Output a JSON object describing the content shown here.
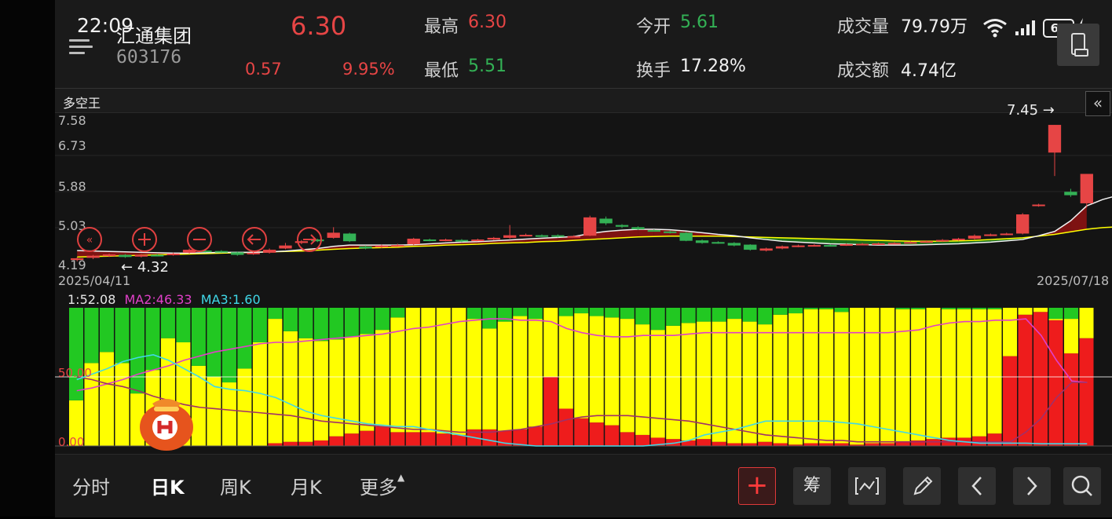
{
  "status_bar": {
    "time": "22:09",
    "battery": "60"
  },
  "stock": {
    "name": "汇通集团",
    "code": "603176",
    "price": "6.30",
    "change": "0.57",
    "change_pct": "9.95%"
  },
  "quote": {
    "high_label": "最高",
    "high": "6.30",
    "low_label": "最低",
    "low": "5.51",
    "open_label": "今开",
    "open": "5.61",
    "turnover_label": "换手",
    "turnover": "17.28%",
    "volume_label": "成交量",
    "volume": "79.79万",
    "amount_label": "成交额",
    "amount": "4.74亿"
  },
  "chart_title": "多空王",
  "colors": {
    "up": "#e64545",
    "down": "#33b155",
    "yellow": "#ffff00",
    "ma1": "#e0e0e0",
    "ma2": "#e040c8",
    "ma3": "#40d8e8"
  },
  "chart_data": [
    {
      "type": "candlestick",
      "title": "多空王",
      "y_ticks": [
        "7.58",
        "6.73",
        "5.88",
        "5.03",
        "4.19"
      ],
      "ylim": [
        4.19,
        7.58
      ],
      "x_start": "2025/04/11",
      "x_end": "2025/07/18",
      "annotations": {
        "high_marker": "7.45",
        "low_marker": "4.32"
      },
      "candles": [
        {
          "o": 4.28,
          "c": 4.32,
          "h": 4.34,
          "l": 4.25
        },
        {
          "o": 4.33,
          "c": 4.38,
          "h": 4.4,
          "l": 4.3
        },
        {
          "o": 4.37,
          "c": 4.41,
          "h": 4.43,
          "l": 4.35
        },
        {
          "o": 4.4,
          "c": 4.35,
          "h": 4.42,
          "l": 4.33
        },
        {
          "o": 4.36,
          "c": 4.4,
          "h": 4.42,
          "l": 4.34
        },
        {
          "o": 4.4,
          "c": 4.39,
          "h": 4.42,
          "l": 4.37
        },
        {
          "o": 4.4,
          "c": 4.43,
          "h": 4.45,
          "l": 4.38
        },
        {
          "o": 4.45,
          "c": 4.52,
          "h": 4.55,
          "l": 4.43
        },
        {
          "o": 4.5,
          "c": 4.48,
          "h": 4.52,
          "l": 4.46
        },
        {
          "o": 4.49,
          "c": 4.47,
          "h": 4.51,
          "l": 4.45
        },
        {
          "o": 4.46,
          "c": 4.4,
          "h": 4.48,
          "l": 4.38
        },
        {
          "o": 4.42,
          "c": 4.45,
          "h": 4.47,
          "l": 4.4
        },
        {
          "o": 4.45,
          "c": 4.52,
          "h": 4.55,
          "l": 4.43
        },
        {
          "o": 4.55,
          "c": 4.62,
          "h": 4.68,
          "l": 4.53
        },
        {
          "o": 4.68,
          "c": 4.72,
          "h": 4.75,
          "l": 4.65
        },
        {
          "o": 4.76,
          "c": 4.72,
          "h": 4.78,
          "l": 4.7
        },
        {
          "o": 4.8,
          "c": 4.92,
          "h": 5.05,
          "l": 4.78
        },
        {
          "o": 4.9,
          "c": 4.72,
          "h": 4.92,
          "l": 4.7
        },
        {
          "o": 4.6,
          "c": 4.55,
          "h": 4.62,
          "l": 4.53
        },
        {
          "o": 4.58,
          "c": 4.62,
          "h": 4.64,
          "l": 4.56
        },
        {
          "o": 4.62,
          "c": 4.63,
          "h": 4.66,
          "l": 4.6
        },
        {
          "o": 4.65,
          "c": 4.78,
          "h": 4.8,
          "l": 4.63
        },
        {
          "o": 4.76,
          "c": 4.74,
          "h": 4.78,
          "l": 4.72
        },
        {
          "o": 4.74,
          "c": 4.76,
          "h": 4.78,
          "l": 4.72
        },
        {
          "o": 4.75,
          "c": 4.73,
          "h": 4.77,
          "l": 4.7
        },
        {
          "o": 4.75,
          "c": 4.76,
          "h": 4.78,
          "l": 4.73
        },
        {
          "o": 4.76,
          "c": 4.8,
          "h": 4.82,
          "l": 4.74
        },
        {
          "o": 4.8,
          "c": 4.86,
          "h": 5.1,
          "l": 4.78
        },
        {
          "o": 4.86,
          "c": 4.87,
          "h": 4.9,
          "l": 4.84
        },
        {
          "o": 4.86,
          "c": 4.85,
          "h": 4.88,
          "l": 4.82
        },
        {
          "o": 4.86,
          "c": 4.83,
          "h": 4.88,
          "l": 4.81
        },
        {
          "o": 4.84,
          "c": 4.84,
          "h": 4.86,
          "l": 4.82
        },
        {
          "o": 4.85,
          "c": 5.28,
          "h": 5.32,
          "l": 4.84
        },
        {
          "o": 5.25,
          "c": 5.14,
          "h": 5.3,
          "l": 5.1
        },
        {
          "o": 5.1,
          "c": 5.06,
          "h": 5.12,
          "l": 5.03
        },
        {
          "o": 5.05,
          "c": 5.0,
          "h": 5.07,
          "l": 4.98
        },
        {
          "o": 4.98,
          "c": 4.97,
          "h": 5.0,
          "l": 4.95
        },
        {
          "o": 4.95,
          "c": 4.92,
          "h": 4.97,
          "l": 4.9
        },
        {
          "o": 4.92,
          "c": 4.73,
          "h": 4.94,
          "l": 4.72
        },
        {
          "o": 4.74,
          "c": 4.68,
          "h": 4.76,
          "l": 4.66
        },
        {
          "o": 4.7,
          "c": 4.68,
          "h": 4.72,
          "l": 4.66
        },
        {
          "o": 4.68,
          "c": 4.62,
          "h": 4.7,
          "l": 4.6
        },
        {
          "o": 4.64,
          "c": 4.52,
          "h": 4.65,
          "l": 4.5
        },
        {
          "o": 4.5,
          "c": 4.55,
          "h": 4.57,
          "l": 4.48
        },
        {
          "o": 4.55,
          "c": 4.6,
          "h": 4.62,
          "l": 4.53
        },
        {
          "o": 4.6,
          "c": 4.62,
          "h": 4.64,
          "l": 4.58
        },
        {
          "o": 4.62,
          "c": 4.63,
          "h": 4.65,
          "l": 4.6
        },
        {
          "o": 4.63,
          "c": 4.62,
          "h": 4.65,
          "l": 4.6
        },
        {
          "o": 4.63,
          "c": 4.65,
          "h": 4.67,
          "l": 4.61
        },
        {
          "o": 4.65,
          "c": 4.66,
          "h": 4.68,
          "l": 4.63
        },
        {
          "o": 4.66,
          "c": 4.67,
          "h": 4.69,
          "l": 4.64
        },
        {
          "o": 4.67,
          "c": 4.68,
          "h": 4.7,
          "l": 4.65
        },
        {
          "o": 4.68,
          "c": 4.7,
          "h": 4.72,
          "l": 4.66
        },
        {
          "o": 4.7,
          "c": 4.72,
          "h": 4.74,
          "l": 4.68
        },
        {
          "o": 4.72,
          "c": 4.75,
          "h": 4.77,
          "l": 4.7
        },
        {
          "o": 4.75,
          "c": 4.78,
          "h": 4.8,
          "l": 4.73
        },
        {
          "o": 4.78,
          "c": 4.85,
          "h": 4.88,
          "l": 4.76
        },
        {
          "o": 4.86,
          "c": 4.88,
          "h": 4.9,
          "l": 4.84
        },
        {
          "o": 4.88,
          "c": 4.9,
          "h": 4.92,
          "l": 4.86
        },
        {
          "o": 4.9,
          "c": 5.35,
          "h": 5.38,
          "l": 4.88
        },
        {
          "o": 5.55,
          "c": 5.58,
          "h": 5.6,
          "l": 5.53
        },
        {
          "o": 6.8,
          "c": 7.45,
          "h": 7.45,
          "l": 6.25
        },
        {
          "o": 5.88,
          "c": 5.8,
          "h": 5.95,
          "l": 5.76
        },
        {
          "o": 5.61,
          "c": 6.3,
          "h": 6.3,
          "l": 5.51
        }
      ],
      "ma_fast": [
        4.5,
        4.49,
        4.48,
        4.47,
        4.46,
        4.45,
        4.44,
        4.44,
        4.45,
        4.46,
        4.46,
        4.46,
        4.47,
        4.49,
        4.52,
        4.55,
        4.6,
        4.63,
        4.63,
        4.63,
        4.63,
        4.64,
        4.66,
        4.68,
        4.7,
        4.71,
        4.73,
        4.75,
        4.77,
        4.79,
        4.81,
        4.83,
        4.9,
        4.95,
        4.98,
        5.0,
        5.0,
        4.99,
        4.96,
        4.92,
        4.88,
        4.85,
        4.8,
        4.76,
        4.72,
        4.7,
        4.68,
        4.66,
        4.65,
        4.64,
        4.63,
        4.63,
        4.63,
        4.64,
        4.65,
        4.66,
        4.68,
        4.7,
        4.73,
        4.76,
        4.85,
        4.95,
        5.2,
        5.55,
        5.7,
        5.8
      ],
      "ma_slow": [
        4.35,
        4.36,
        4.37,
        4.38,
        4.39,
        4.4,
        4.41,
        4.42,
        4.43,
        4.44,
        4.45,
        4.46,
        4.47,
        4.48,
        4.49,
        4.51,
        4.53,
        4.55,
        4.56,
        4.57,
        4.58,
        4.6,
        4.61,
        4.63,
        4.64,
        4.65,
        4.67,
        4.68,
        4.69,
        4.71,
        4.72,
        4.74,
        4.76,
        4.78,
        4.8,
        4.82,
        4.83,
        4.84,
        4.84,
        4.84,
        4.84,
        4.83,
        4.82,
        4.81,
        4.8,
        4.79,
        4.78,
        4.77,
        4.76,
        4.75,
        4.74,
        4.73,
        4.72,
        4.72,
        4.72,
        4.73,
        4.74,
        4.76,
        4.78,
        4.8,
        4.84,
        4.88,
        4.94,
        5.0,
        5.04,
        5.06
      ]
    },
    {
      "type": "stacked-bar",
      "title": "",
      "y_ticks": [
        "50.00",
        "0.00"
      ],
      "ylim": [
        0,
        100
      ],
      "legend": {
        "ma1": "1:52.08",
        "ma2": "MA2:46.33",
        "ma3": "MA3:1.60"
      },
      "series": [
        {
          "name": "red",
          "values": [
            0,
            0,
            0,
            0,
            0,
            0,
            0,
            0,
            0,
            0,
            0,
            0,
            0,
            2,
            3,
            3,
            4,
            7,
            9,
            11,
            14,
            10,
            10,
            10,
            9,
            8,
            12,
            12,
            11,
            12,
            14,
            50,
            27,
            20,
            17,
            15,
            10,
            8,
            6,
            5,
            4,
            5,
            3,
            2,
            2,
            3,
            2,
            1,
            2,
            2,
            2,
            1,
            2,
            2,
            3,
            4,
            5,
            6,
            6,
            7,
            9,
            65,
            95,
            97,
            91,
            67,
            78
          ]
        },
        {
          "name": "yellow",
          "values": [
            33,
            60,
            68,
            60,
            38,
            55,
            78,
            75,
            58,
            50,
            46,
            56,
            75,
            90,
            80,
            75,
            72,
            70,
            70,
            70,
            70,
            83,
            90,
            98,
            99,
            95,
            80,
            73,
            79,
            82,
            78,
            50,
            67,
            76,
            77,
            78,
            82,
            80,
            78,
            82,
            85,
            85,
            87,
            90,
            88,
            85,
            93,
            95,
            97,
            97,
            95,
            99,
            98,
            98,
            96,
            95,
            95,
            93,
            93,
            92,
            90,
            35,
            5,
            3,
            1,
            25,
            22
          ]
        },
        {
          "name": "green",
          "values": [
            67,
            40,
            32,
            40,
            62,
            45,
            22,
            25,
            42,
            50,
            54,
            44,
            25,
            8,
            17,
            22,
            24,
            23,
            21,
            19,
            16,
            7,
            0,
            0,
            0,
            0,
            8,
            15,
            10,
            6,
            8,
            0,
            6,
            4,
            6,
            7,
            8,
            12,
            16,
            13,
            11,
            10,
            10,
            8,
            10,
            12,
            5,
            4,
            1,
            1,
            3,
            0,
            0,
            0,
            1,
            1,
            0,
            1,
            1,
            1,
            1,
            0,
            0,
            0,
            8,
            8,
            0
          ]
        }
      ],
      "ma1": [
        40,
        42,
        45,
        48,
        52,
        55,
        58,
        62,
        65,
        68,
        70,
        72,
        74,
        75,
        75,
        76,
        77,
        78,
        79,
        80,
        81,
        83,
        85,
        86,
        88,
        90,
        91,
        92,
        92,
        91,
        91,
        90,
        85,
        82,
        80,
        79,
        79,
        80,
        80,
        80,
        81,
        82,
        82,
        82,
        82,
        82,
        82,
        82,
        82,
        82,
        82,
        82,
        82,
        82,
        83,
        84,
        87,
        89,
        90,
        90,
        91,
        91,
        92,
        80,
        62,
        47,
        46
      ],
      "ma2": [
        50,
        48,
        45,
        43,
        40,
        36,
        33,
        30,
        28,
        27,
        26,
        25,
        24,
        23,
        22,
        20,
        18,
        17,
        16,
        15,
        14,
        13,
        12,
        12,
        11,
        10,
        10,
        10,
        11,
        12,
        14,
        16,
        19,
        21,
        22,
        22,
        22,
        21,
        20,
        19,
        18,
        16,
        14,
        12,
        10,
        8,
        7,
        6,
        5,
        4,
        4,
        3,
        3,
        3,
        3,
        3,
        3,
        3,
        3,
        3,
        3,
        3,
        10,
        20,
        35,
        46,
        46
      ],
      "ma3": [
        48,
        52,
        56,
        61,
        64,
        66,
        62,
        56,
        50,
        43,
        41,
        40,
        38,
        35,
        30,
        25,
        22,
        20,
        18,
        16,
        15,
        14,
        14,
        12,
        10,
        8,
        6,
        4,
        2,
        1,
        0,
        0,
        0,
        0,
        0,
        0,
        0,
        0,
        1,
        2,
        4,
        8,
        10,
        12,
        15,
        18,
        18,
        18,
        18,
        18,
        17,
        16,
        14,
        12,
        10,
        8,
        6,
        4,
        3,
        2,
        2,
        2,
        2,
        1.6,
        1.6,
        1.6,
        1.6
      ]
    }
  ],
  "bottom_tabs": [
    "分时",
    "日K",
    "周K",
    "月K",
    "更多"
  ],
  "toolbar": {
    "chip_label": "筹"
  }
}
